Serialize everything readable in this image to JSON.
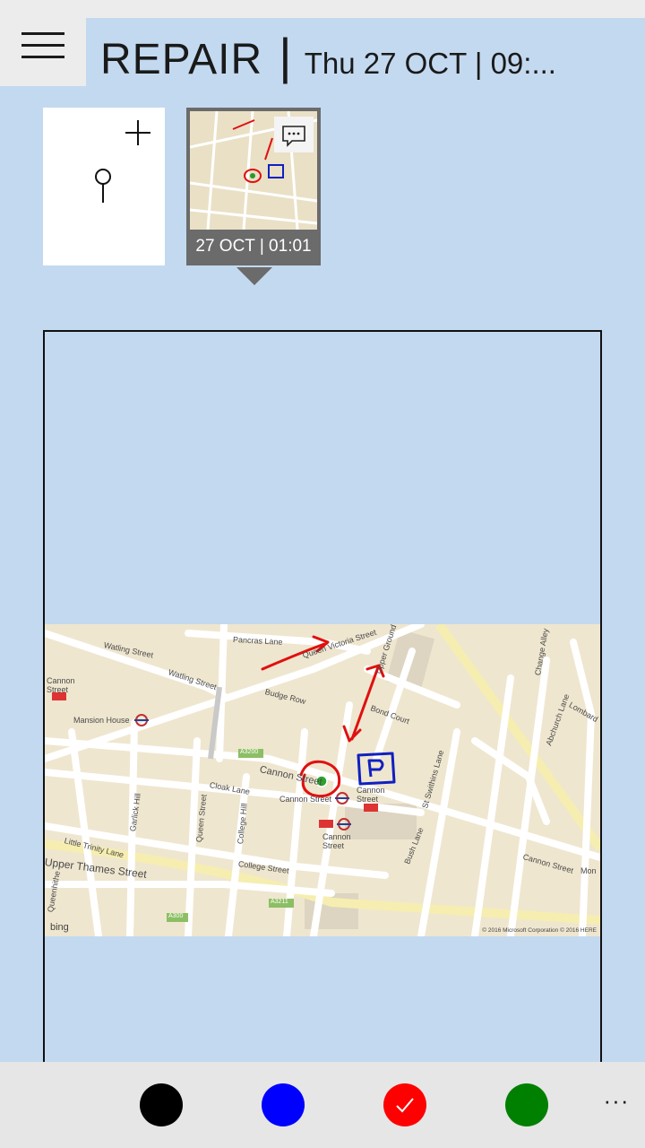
{
  "header": {
    "app_title": "REPAIR",
    "separator": "|",
    "datetime": "Thu 27 OCT | 09:..."
  },
  "tiles": {
    "add": {
      "plus_icon": "plus-icon",
      "pin_icon": "map-pin-icon"
    },
    "items": [
      {
        "label": "27 OCT | 01:01",
        "icon": "comment-icon",
        "selected": true
      }
    ]
  },
  "map": {
    "labels": {
      "watling1": "Watling Street",
      "watling2": "Watling Street",
      "pancras": "Pancras Lane",
      "queen_victoria": "Queen Victoria Street",
      "upper_ground": "Upper Ground",
      "budge": "Budge Row",
      "bond": "Bond Court",
      "cannon_top": "Cannon",
      "cannon_top2": "Street",
      "mansion": "Mansion House",
      "a3200": "A3200",
      "cannon_street": "Cannon Street",
      "cloak": "Cloak Lane",
      "cannon_st2": "Cannon Street",
      "cannon_station1": "Cannon",
      "cannon_station2": "Street",
      "cannon_lower1": "Cannon",
      "cannon_lower2": "Street",
      "garlick": "Garlick Hill",
      "queen_st": "Queen Street",
      "college_hill": "College Hill",
      "little_trinity": "Little Trinity Lane",
      "upper_thames": "Upper Thames Street",
      "college_st": "College Street",
      "bush": "Bush Lane",
      "st_swithins": "St Swithins Lane",
      "abchurch": "Abchurch Lane",
      "change_alley": "Change Alley",
      "lombard": "Lombard",
      "cannon_east": "Cannon Street",
      "mon": "Mon",
      "queenhithe": "Queenhithe",
      "a3211": "A3211",
      "a300": "A300"
    },
    "bing": "bing",
    "copyright": "© 2016 Microsoft Corporation © 2016 HERE",
    "annotation_color": "#e01010",
    "parking_color": "#1020c0"
  },
  "toolbar": {
    "colors": [
      {
        "name": "black",
        "hex": "#000000",
        "selected": false
      },
      {
        "name": "blue",
        "hex": "#0000ff",
        "selected": false
      },
      {
        "name": "red",
        "hex": "#ff0000",
        "selected": true
      },
      {
        "name": "green",
        "hex": "#008000",
        "selected": false
      }
    ],
    "more_label": "···"
  }
}
